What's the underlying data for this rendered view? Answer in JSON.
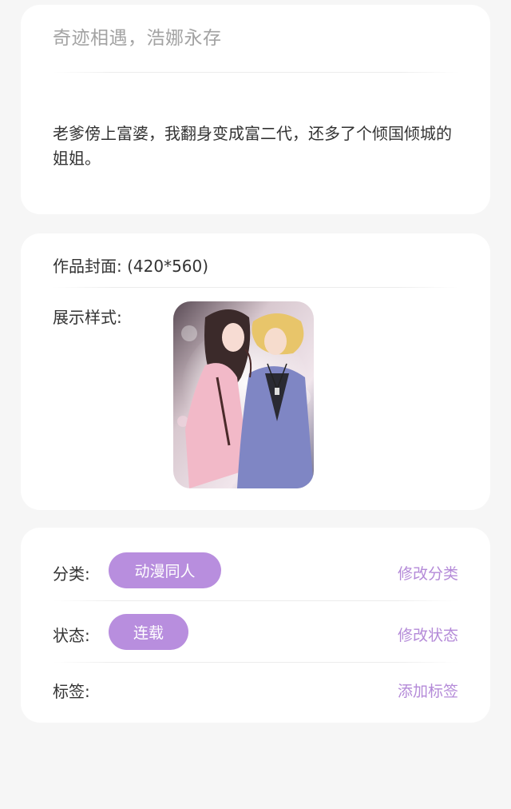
{
  "work": {
    "title": "奇迹相遇，浩娜永存",
    "intro": "老爹傍上富婆，我翻身变成富二代，还多了个倾国倾城的姐姐。"
  },
  "cover": {
    "label": "作品封面: (420*560)",
    "style_label": "展示样式:",
    "image": "anime-couple-cover-illustration"
  },
  "meta": {
    "category_label": "分类:",
    "category_value": "动漫同人",
    "category_action": "修改分类",
    "status_label": "状态:",
    "status_value": "连载",
    "status_action": "修改状态",
    "tags_label": "标签:",
    "tags_action": "添加标签"
  },
  "colors": {
    "accent": "#b88ede",
    "link": "#b48ad8",
    "background": "#f6f6f6",
    "card": "#ffffff"
  }
}
